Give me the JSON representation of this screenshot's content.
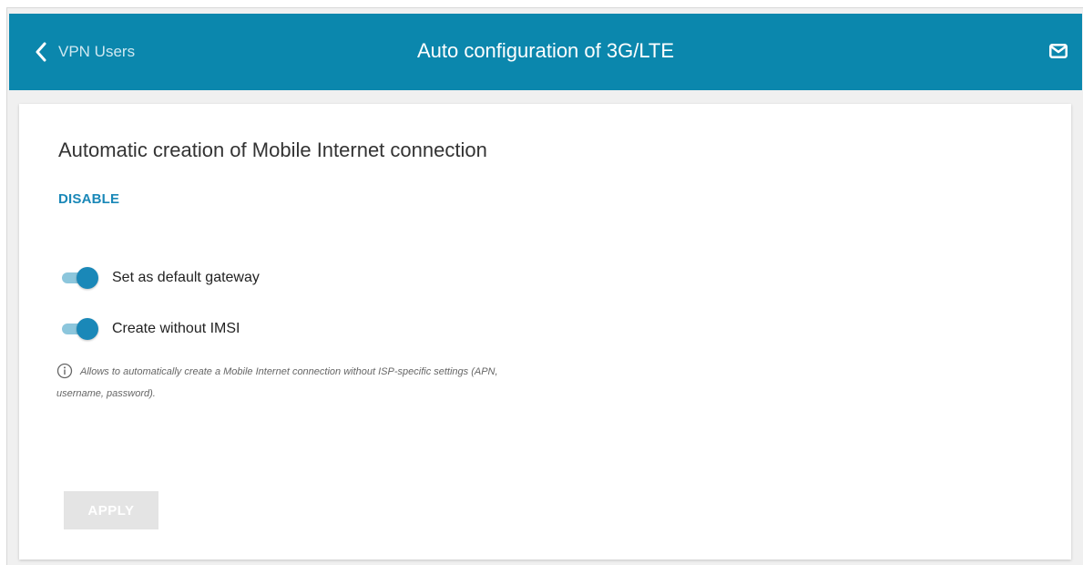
{
  "header": {
    "back_label": "VPN Users",
    "title": "Auto configuration of 3G/LTE",
    "back_icon": "chevron-left-icon",
    "mail_icon": "mail-icon"
  },
  "card": {
    "title": "Automatic creation of Mobile Internet connection",
    "disable_link": "DISABLE",
    "toggles": [
      {
        "label": "Set as default gateway",
        "checked": true
      },
      {
        "label": "Create without IMSI",
        "checked": true
      }
    ],
    "hint_icon": "info-icon",
    "hint": "Allows to automatically create a Mobile Internet connection without ISP-specific settings (APN, username, password).",
    "apply_label": "APPLY",
    "apply_disabled": true
  },
  "colors": {
    "header_bg": "#0b87ad",
    "accent": "#1a88b8",
    "toggle_track": "#8cc6dc",
    "button_disabled": "#e4e4e4"
  }
}
